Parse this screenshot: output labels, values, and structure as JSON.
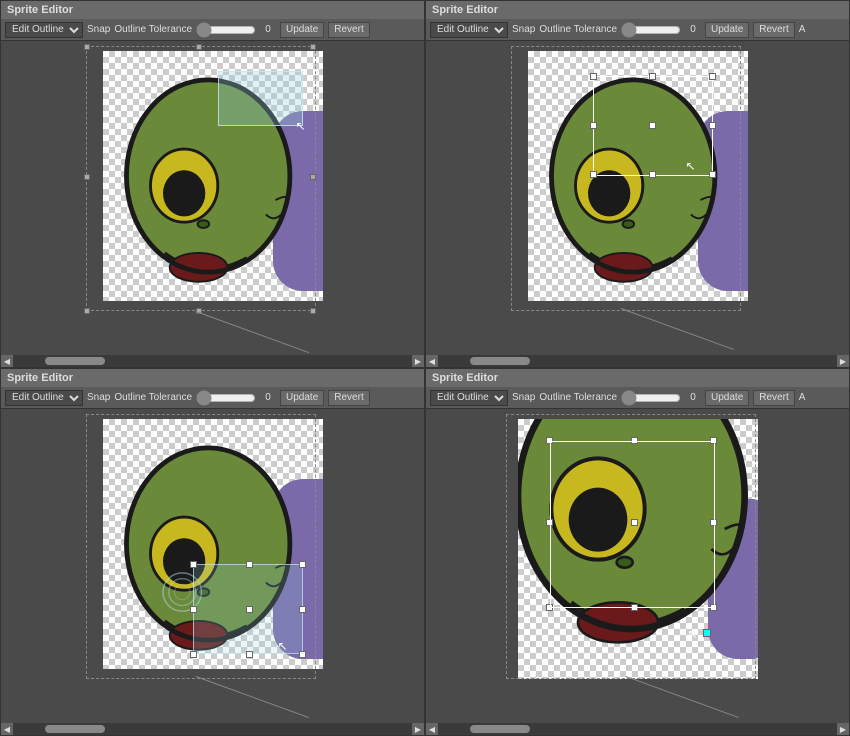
{
  "panels": [
    {
      "id": "panel-tl",
      "title": "Sprite Editor",
      "toolbar": {
        "dropdown_label": "Edit Outline",
        "snap_label": "Snap",
        "tolerance_label": "Outline Tolerance",
        "tolerance_value": "0",
        "update_label": "Update",
        "revert_label": "Revert"
      },
      "description": "top-left panel with selection rectangle near head"
    },
    {
      "id": "panel-tr",
      "title": "Sprite Editor",
      "toolbar": {
        "dropdown_label": "Edit Outline",
        "snap_label": "Snap",
        "tolerance_label": "Outline Tolerance",
        "tolerance_value": "0",
        "update_label": "Update",
        "revert_label": "Revert"
      },
      "description": "top-right panel with bounding box handles"
    },
    {
      "id": "panel-bl",
      "title": "Sprite Editor",
      "toolbar": {
        "dropdown_label": "Edit Outline",
        "snap_label": "Snap",
        "tolerance_label": "Outline Tolerance",
        "tolerance_value": "0",
        "update_label": "Update",
        "revert_label": "Revert"
      },
      "description": "bottom-left panel with selection at mouth area"
    },
    {
      "id": "panel-br",
      "title": "Sprite Editor",
      "toolbar": {
        "dropdown_label": "Edit Outline",
        "snap_label": "Snap",
        "tolerance_label": "Outline Tolerance",
        "tolerance_value": "0",
        "update_label": "Update",
        "revert_label": "Revert"
      },
      "description": "bottom-right panel zoomed in on eye area"
    }
  ]
}
